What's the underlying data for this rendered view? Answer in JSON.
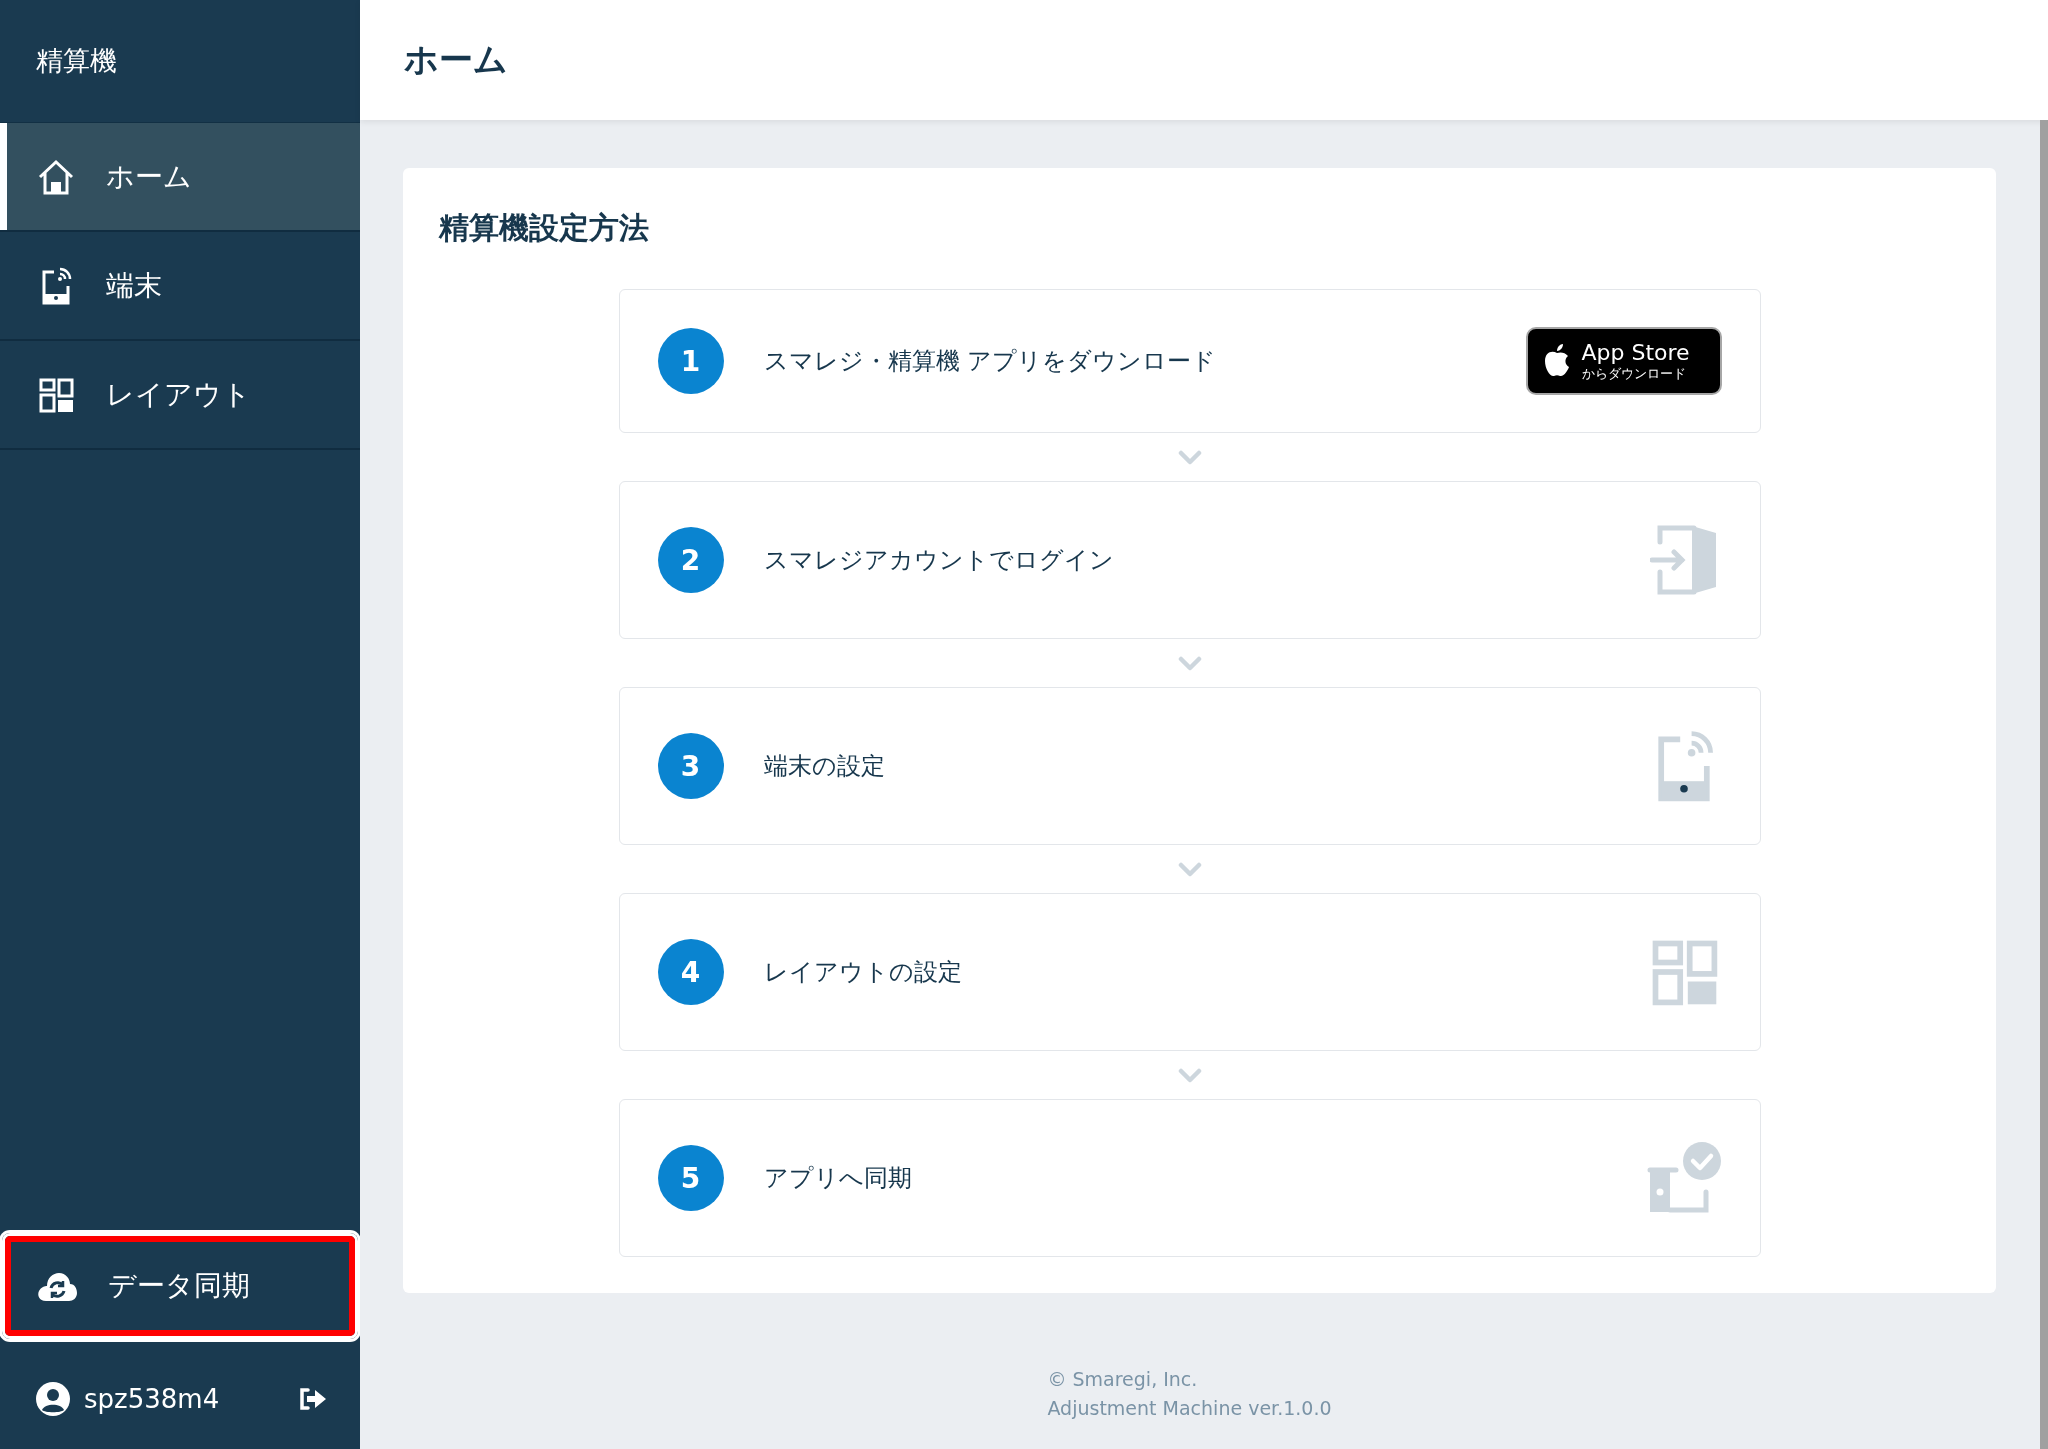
{
  "sidebar": {
    "title": "精算機",
    "items": [
      {
        "label": "ホーム",
        "kind": "home",
        "selected": true
      },
      {
        "label": "端末",
        "kind": "terminal",
        "selected": false
      },
      {
        "label": "レイアウト",
        "kind": "layout",
        "selected": false
      }
    ],
    "sync": {
      "label": "データ同期",
      "highlighted": true
    },
    "user": {
      "name": "spz538m4"
    }
  },
  "header": {
    "title": "ホーム"
  },
  "card": {
    "title": "精算機設定方法",
    "steps": [
      {
        "number": "1",
        "label": "スマレジ・精算機 アプリをダウンロード",
        "kind": "appstore",
        "badge": {
          "title": "App Store",
          "subtitle": "からダウンロード"
        }
      },
      {
        "number": "2",
        "label": "スマレジアカウントでログイン",
        "kind": "login"
      },
      {
        "number": "3",
        "label": "端末の設定",
        "kind": "terminal"
      },
      {
        "number": "4",
        "label": "レイアウトの設定",
        "kind": "layout"
      },
      {
        "number": "5",
        "label": "アプリへ同期",
        "kind": "sync"
      }
    ]
  },
  "footer": {
    "copyright": "© Smaregi, Inc.",
    "version": "Adjustment Machine ver.1.0.0"
  }
}
